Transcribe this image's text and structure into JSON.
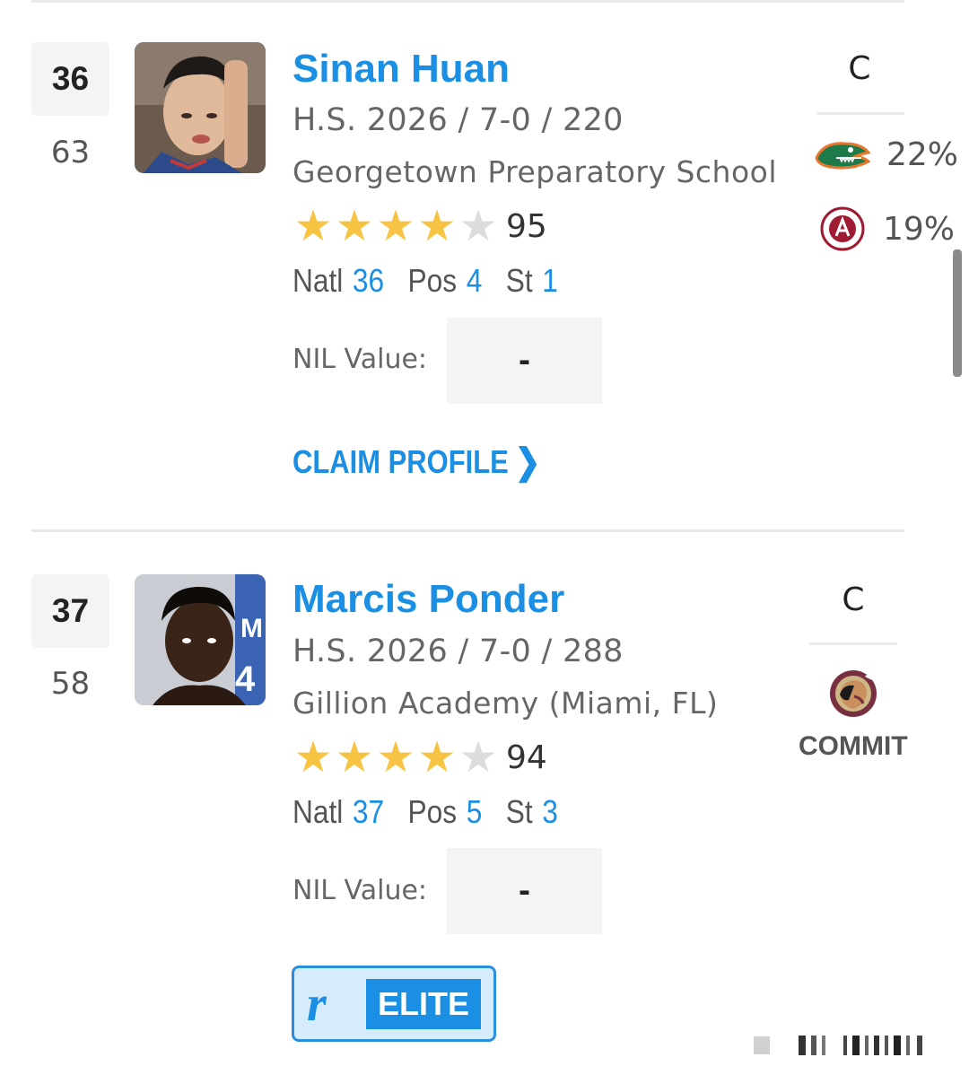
{
  "players": [
    {
      "rank": "36",
      "prev_rank": "63",
      "name": "Sinan Huan",
      "meta": "H.S. 2026 / 7-0 / 220",
      "school": "Georgetown Preparatory School",
      "stars": 4,
      "rating": "95",
      "natl_label": "Natl",
      "natl": "36",
      "pos_label": "Pos",
      "pos": "4",
      "st_label": "St",
      "st": "1",
      "nil_label": "NIL Value:",
      "nil_value": "-",
      "position": "C",
      "predictions": [
        {
          "pct": "22%",
          "icon": "gator-logo-icon"
        },
        {
          "pct": "19%",
          "icon": "alabama-logo-icon"
        }
      ],
      "cta": "CLAIM PROFILE"
    },
    {
      "rank": "37",
      "prev_rank": "58",
      "name": "Marcis Ponder",
      "meta": "H.S. 2026 / 7-0 / 288",
      "school": "Gillion Academy (Miami, FL)",
      "stars": 4,
      "rating": "94",
      "natl_label": "Natl",
      "natl": "37",
      "pos_label": "Pos",
      "pos": "5",
      "st_label": "St",
      "st": "3",
      "nil_label": "NIL Value:",
      "nil_value": "-",
      "position": "C",
      "commit_icon": "seminole-logo-icon",
      "commit_label": "COMMIT",
      "badge_label": "ELITE"
    }
  ],
  "colors": {
    "link": "#1a8fe3",
    "star": "#f6c343",
    "gator_green": "#1f7a4a",
    "crimson": "#9e1b32",
    "garnet": "#782f40"
  }
}
